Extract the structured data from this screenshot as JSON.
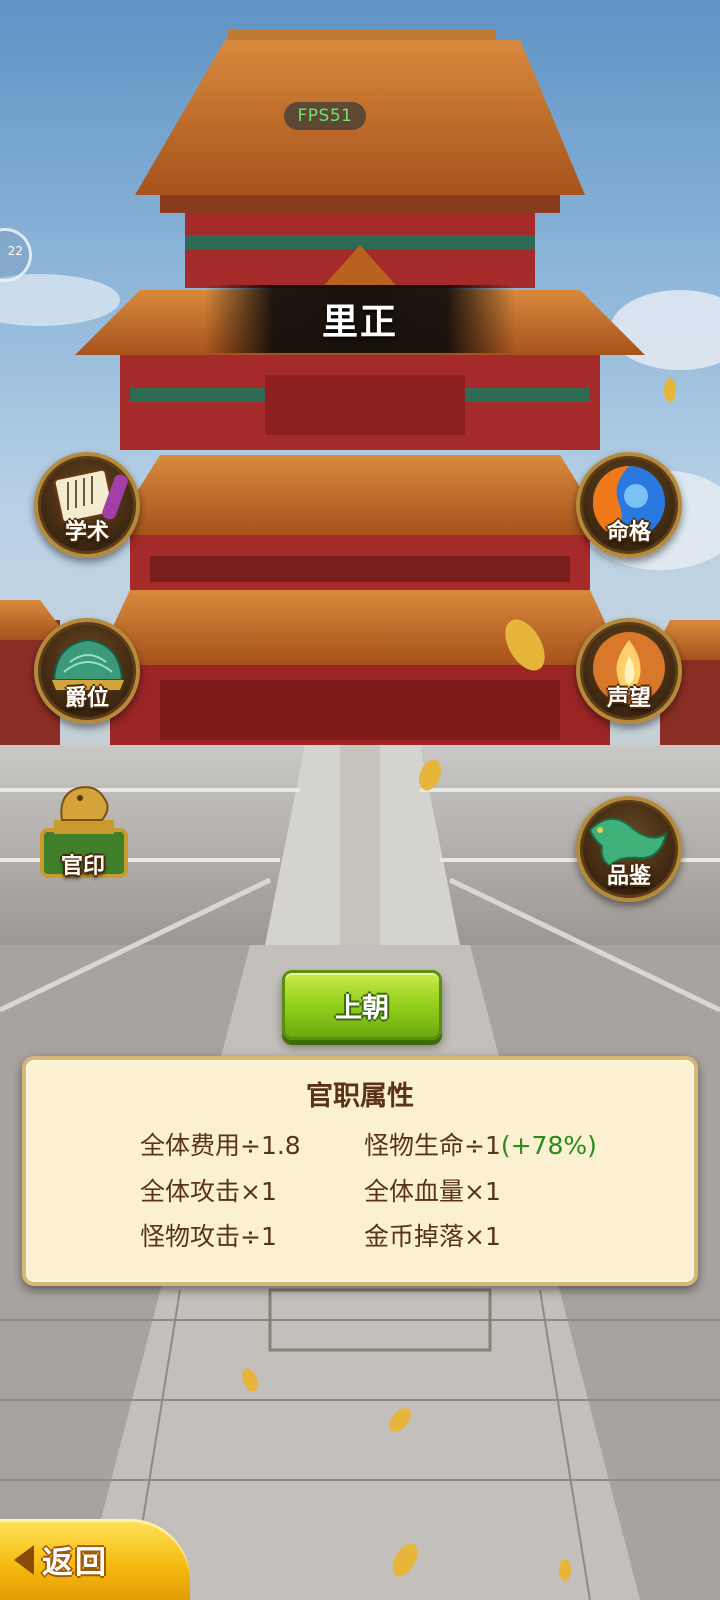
{
  "hud": {
    "fps": "FPS51",
    "side_orb_text": "22"
  },
  "rank": {
    "title": "里正"
  },
  "menu": {
    "left": [
      {
        "label": "学术",
        "icon": "scroll-book-icon"
      },
      {
        "label": "爵位",
        "icon": "official-hat-icon"
      },
      {
        "label": "官印",
        "icon": "official-seal-icon"
      }
    ],
    "right": [
      {
        "label": "命格",
        "icon": "fire-ice-orb-icon"
      },
      {
        "label": "声望",
        "icon": "flame-emblem-icon"
      },
      {
        "label": "品鉴",
        "icon": "jade-dragon-icon"
      }
    ]
  },
  "court_button": {
    "label": "上朝"
  },
  "attributes": {
    "title": "官职属性",
    "items": [
      {
        "text": "全体费用÷1.8",
        "bonus": ""
      },
      {
        "text": "怪物生命÷1",
        "bonus": "(+78%)"
      },
      {
        "text": "全体攻击×1",
        "bonus": ""
      },
      {
        "text": "全体血量×1",
        "bonus": ""
      },
      {
        "text": "怪物攻击÷1",
        "bonus": ""
      },
      {
        "text": "金币掉落×1",
        "bonus": ""
      }
    ]
  },
  "back_button": {
    "label": "返回"
  },
  "colors": {
    "roof": "#c0672a",
    "wall": "#a52a2a",
    "panel_bg": "#fbf1d2",
    "panel_text": "#5b3417",
    "bonus": "#2a8a1c",
    "court_button": "#8fcc1a",
    "back_button": "#f5b90f"
  }
}
